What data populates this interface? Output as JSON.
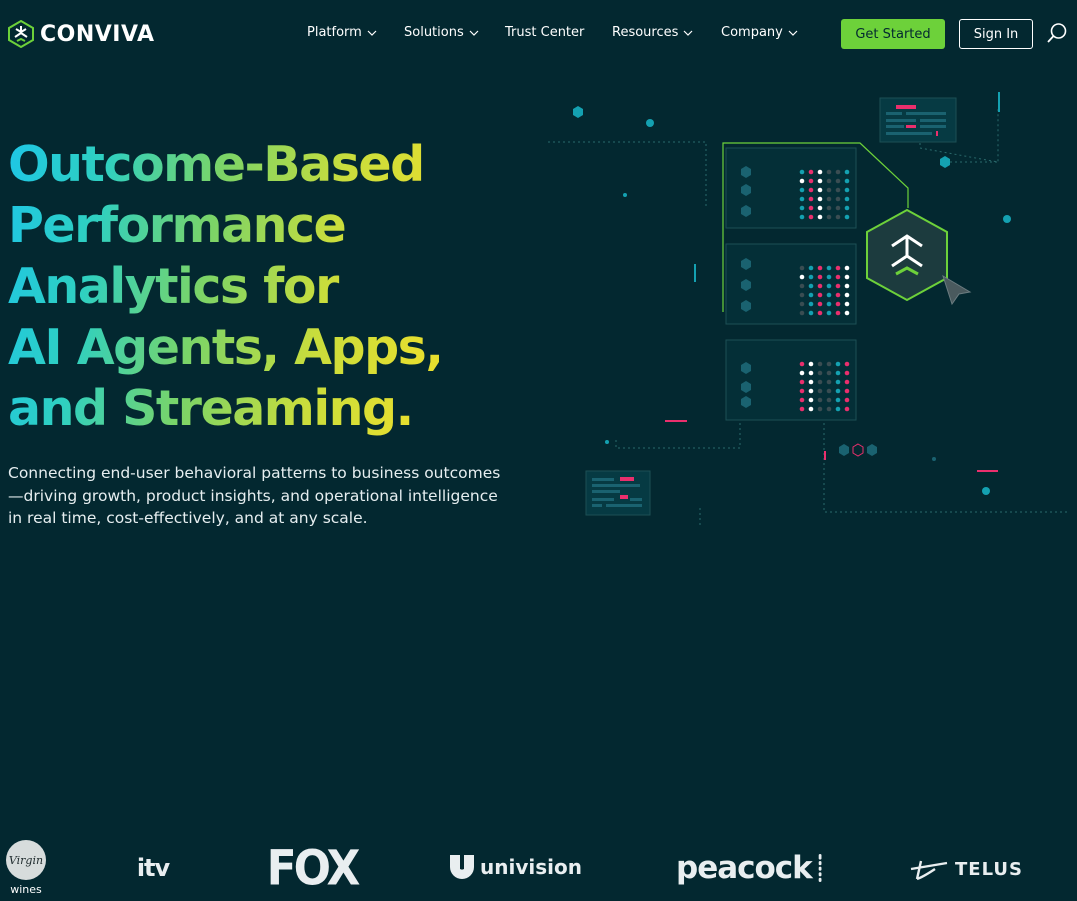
{
  "brand": {
    "name": "CONVIVA",
    "accent": "#6dd13a",
    "background": "#032830"
  },
  "nav": {
    "items": [
      {
        "label": "Platform",
        "has_dropdown": true
      },
      {
        "label": "Solutions",
        "has_dropdown": true
      },
      {
        "label": "Trust Center",
        "has_dropdown": false
      },
      {
        "label": "Resources",
        "has_dropdown": true
      },
      {
        "label": "Company",
        "has_dropdown": true
      }
    ],
    "get_started_label": "Get Started",
    "sign_in_label": "Sign In",
    "search_icon": "search-icon"
  },
  "hero": {
    "headline_lines": [
      "Outcome-Based",
      "Performance",
      "Analytics for",
      "AI Agents, Apps,",
      "and Streaming."
    ],
    "subtext": "Connecting end-user behavioral patterns to business outcomes—driving growth, product insights, and operational intelligence in real time, cost-effectively, and at any scale."
  },
  "customer_logos": [
    {
      "name": "virgin-wines",
      "text": "Virgin",
      "subtext": "wines"
    },
    {
      "name": "itv",
      "text": "itv"
    },
    {
      "name": "fox",
      "text": "FOX"
    },
    {
      "name": "univision",
      "text": "univision"
    },
    {
      "name": "peacock",
      "text": "peacock"
    },
    {
      "name": "telus",
      "text": "TELUS"
    }
  ]
}
